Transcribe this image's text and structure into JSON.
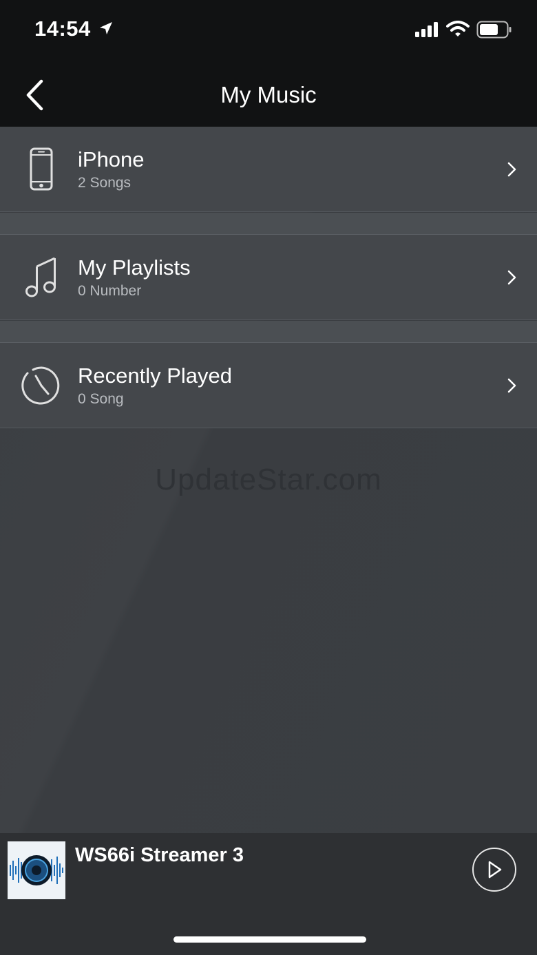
{
  "status_bar": {
    "time": "14:54",
    "icons": [
      "location-arrow-icon",
      "cellular-signal-icon",
      "wifi-icon",
      "battery-icon"
    ]
  },
  "nav": {
    "title": "My Music",
    "back_icon": "chevron-left-icon"
  },
  "items": [
    {
      "title": "iPhone",
      "subtitle": "2 Songs",
      "icon": "phone-icon"
    },
    {
      "title": "My Playlists",
      "subtitle": "0 Number",
      "icon": "music-note-icon"
    },
    {
      "title": "Recently Played",
      "subtitle": "0 Song",
      "icon": "clock-icon"
    }
  ],
  "watermark": "UpdateStar.com",
  "player": {
    "track_title": "WS66i Streamer 3",
    "play_icon": "play-icon"
  },
  "colors": {
    "header_bg": "#111213",
    "row_bg": "#44474b",
    "content_bg": "#3a3d41",
    "player_bg": "#2e3033",
    "subtitle_text": "#b9bcc0"
  }
}
